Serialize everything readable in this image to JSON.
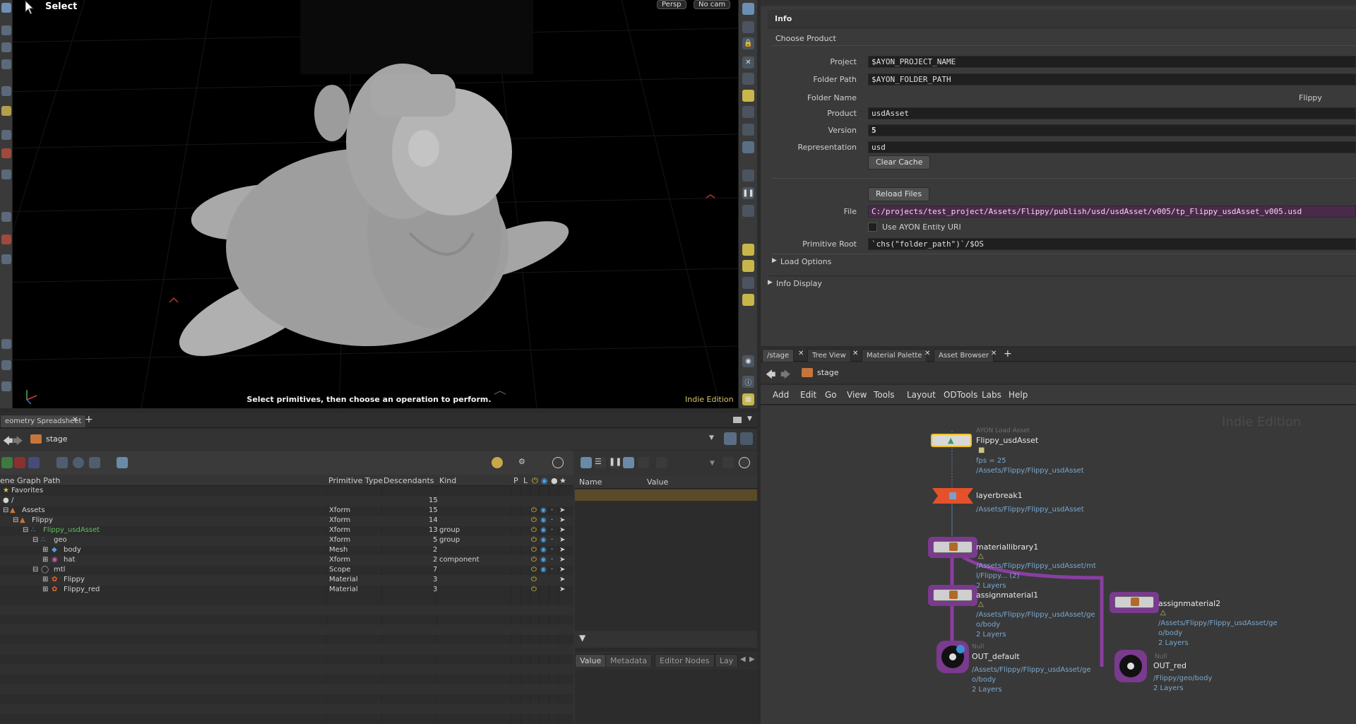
{
  "viewport": {
    "tool_title": "Select",
    "persp_menu": "Persp",
    "camera_menu": "No cam",
    "hint": "Select primitives, then choose an operation to perform.",
    "edition": "Indie Edition"
  },
  "parameters": {
    "tab": "Info",
    "section": "Choose Product",
    "fields": [
      {
        "label": "Project",
        "value": "$AYON_PROJECT_NAME"
      },
      {
        "label": "Folder Path",
        "value": "$AYON_FOLDER_PATH"
      },
      {
        "label": "Folder Name",
        "value": "Flippy"
      },
      {
        "label": "Product",
        "value": "usdAsset"
      },
      {
        "label": "Version",
        "value": "5"
      },
      {
        "label": "Representation",
        "value": "usd"
      }
    ],
    "clear_cache": "Clear Cache",
    "reload_files": "Reload Files",
    "file_label": "File",
    "file_value": "C:/projects/test_project/Assets/Flippy/publish/usd/usdAsset/v005/tp_Flippy_usdAsset_v005.usd",
    "use_entity_uri": "Use AYON Entity URI",
    "primitive_root_label": "Primitive Root",
    "primitive_root_value": "`chs(\"folder_path\")`/$OS",
    "load_options": "Load Options",
    "info_display": "Info Display"
  },
  "network": {
    "tabs": [
      "/stage",
      "Tree View",
      "Material Palette",
      "Asset Browser"
    ],
    "path": "stage",
    "menu": [
      "Add",
      "Edit",
      "Go",
      "View",
      "Tools",
      "Layout",
      "ODTools",
      "Labs",
      "Help"
    ],
    "watermark": "Indie Edition",
    "nodes": [
      {
        "name": "Flippy_usdAsset",
        "type": "AYON Load Asset",
        "info": [
          "fps = 25",
          "/Assets/Flippy/Flippy_usdAsset"
        ]
      },
      {
        "name": "layerbreak1",
        "info": [
          "/Assets/Flippy/Flippy_usdAsset"
        ]
      },
      {
        "name": "materiallibrary1",
        "info": [
          "/Assets/Flippy/Flippy_usdAsset/mt",
          "l/Flippy... (2)",
          "2 Layers"
        ]
      },
      {
        "name": "assignmaterial1",
        "info": [
          "/Assets/Flippy/Flippy_usdAsset/ge",
          "o/body",
          "2 Layers"
        ]
      },
      {
        "name": "assignmaterial2",
        "info": [
          "/Assets/Flippy/Flippy_usdAsset/ge",
          "o/body",
          "2 Layers"
        ]
      },
      {
        "name": "OUT_default",
        "type": "Null",
        "info": [
          "/Assets/Flippy/Flippy_usdAsset/ge",
          "o/body",
          "2 Layers"
        ]
      },
      {
        "name": "OUT_red",
        "type": "Null",
        "info": [
          "/Flippy/geo/body",
          "2 Layers"
        ]
      }
    ]
  },
  "spreadsheet": {
    "tab": "eometry Spreadsheet",
    "path": "stage",
    "columns": [
      "ene Graph Path",
      "Primitive Type",
      "Descendants",
      "Kind",
      "P",
      "L"
    ],
    "favorites": "Favorites",
    "rows": [
      {
        "name": "/",
        "type": "",
        "desc": "15",
        "kind": ""
      },
      {
        "name": "Assets",
        "type": "Xform",
        "desc": "15",
        "kind": ""
      },
      {
        "name": "Flippy",
        "type": "Xform",
        "desc": "14",
        "kind": ""
      },
      {
        "name": "Flippy_usdAsset",
        "type": "Xform",
        "desc": "13",
        "kind": "group"
      },
      {
        "name": "geo",
        "type": "Xform",
        "desc": "5",
        "kind": "group"
      },
      {
        "name": "body",
        "type": "Mesh",
        "desc": "2",
        "kind": ""
      },
      {
        "name": "hat",
        "type": "Xform",
        "desc": "2",
        "kind": "component"
      },
      {
        "name": "mtl",
        "type": "Scope",
        "desc": "7",
        "kind": ""
      },
      {
        "name": "Flippy",
        "type": "Material",
        "desc": "3",
        "kind": ""
      },
      {
        "name": "Flippy_red",
        "type": "Material",
        "desc": "3",
        "kind": ""
      }
    ],
    "detail_columns": [
      "Name",
      "Value"
    ],
    "detail_tabs": [
      "Value",
      "Metadata",
      "Editor Nodes",
      "Lay"
    ]
  }
}
